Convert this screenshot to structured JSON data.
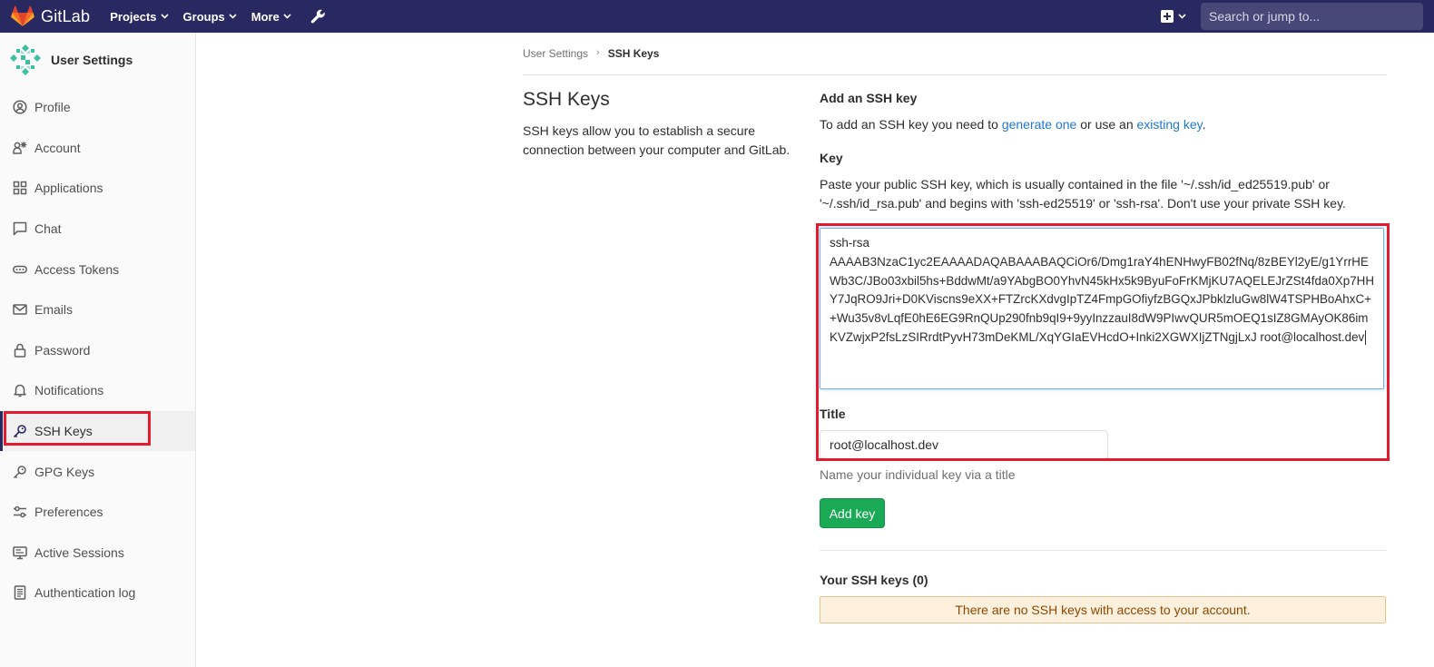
{
  "navbar": {
    "brand": "GitLab",
    "items": [
      {
        "label": "Projects"
      },
      {
        "label": "Groups"
      },
      {
        "label": "More"
      }
    ],
    "search_placeholder": "Search or jump to...",
    "background": "#292961"
  },
  "sidebar": {
    "title": "User Settings",
    "items": [
      {
        "label": "Profile",
        "icon": "profile-icon"
      },
      {
        "label": "Account",
        "icon": "account-icon"
      },
      {
        "label": "Applications",
        "icon": "applications-icon"
      },
      {
        "label": "Chat",
        "icon": "chat-icon"
      },
      {
        "label": "Access Tokens",
        "icon": "token-icon"
      },
      {
        "label": "Emails",
        "icon": "mail-icon"
      },
      {
        "label": "Password",
        "icon": "lock-icon"
      },
      {
        "label": "Notifications",
        "icon": "bell-icon"
      },
      {
        "label": "SSH Keys",
        "icon": "key-icon",
        "active": true
      },
      {
        "label": "GPG Keys",
        "icon": "key-icon"
      },
      {
        "label": "Preferences",
        "icon": "settings-icon"
      },
      {
        "label": "Active Sessions",
        "icon": "monitor-icon"
      },
      {
        "label": "Authentication log",
        "icon": "log-icon"
      }
    ]
  },
  "breadcrumb": {
    "parent": "User Settings",
    "current": "SSH Keys"
  },
  "page": {
    "title": "SSH Keys",
    "description": "SSH keys allow you to establish a secure connection between your computer and GitLab."
  },
  "form": {
    "heading": "Add an SSH key",
    "intro_before": "To add an SSH key you need to ",
    "intro_link1": "generate one",
    "intro_middle": " or use an ",
    "intro_link2": "existing key",
    "intro_after": ".",
    "key_label": "Key",
    "key_help": "Paste your public SSH key, which is usually contained in the file '~/.ssh/id_ed25519.pub' or '~/.ssh/id_rsa.pub' and begins with 'ssh-ed25519' or 'ssh-rsa'. Don't use your private SSH key.",
    "key_value": "ssh-rsa\nAAAAB3NzaC1yc2EAAAADAQABAAABAQCiOr6/Dmg1raY4hENHwyFB02fNq/8zBEYl2yE/g1YrrHEWb3C/JBo03xbil5hs+BddwMt/a9YAbgBO0YhvN45kHx5k9ByuFoFrKMjKU7AQELEJrZSt4fda0Xp7HHY7JqRO9Jri+D0KViscns9eXX+FTZrcKXdvgIpTZ4FmpGOfiyfzBGQxJPbklzluGw8lW4TSPHBoAhxC++Wu35v8vLqfE0hE6EG9RnQUp290fnb9qI9+9yyInzzauI8dW9PIwvQUR5mOEQ1sIZ8GMAyOK86imKVZwjxP2fsLzSIRrdtPyvH73mDeKML/XqYGIaEVHcdO+Inki2XGWXIjZTNgjLxJ root@localhost.dev",
    "title_label": "Title",
    "title_value": "root@localhost.dev",
    "title_help": "Name your individual key via a title",
    "submit_label": "Add key",
    "submit_color": "#1aaa55"
  },
  "keys_list": {
    "heading": "Your SSH keys (0)",
    "empty_message": "There are no SSH keys with access to your account."
  }
}
